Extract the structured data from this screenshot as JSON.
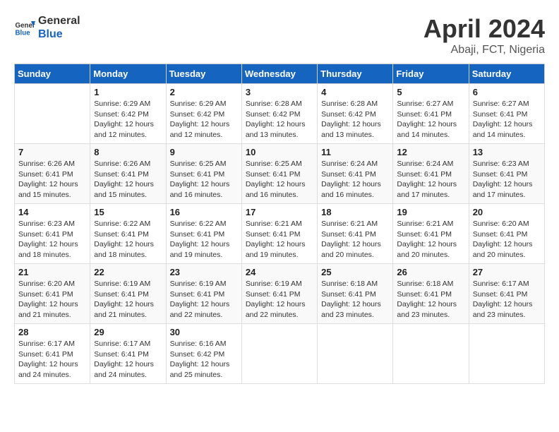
{
  "logo": {
    "general": "General",
    "blue": "Blue"
  },
  "title": "April 2024",
  "location": "Abaji, FCT, Nigeria",
  "weekdays": [
    "Sunday",
    "Monday",
    "Tuesday",
    "Wednesday",
    "Thursday",
    "Friday",
    "Saturday"
  ],
  "weeks": [
    [
      {
        "day": "",
        "info": ""
      },
      {
        "day": "1",
        "info": "Sunrise: 6:29 AM\nSunset: 6:42 PM\nDaylight: 12 hours\nand 12 minutes."
      },
      {
        "day": "2",
        "info": "Sunrise: 6:29 AM\nSunset: 6:42 PM\nDaylight: 12 hours\nand 12 minutes."
      },
      {
        "day": "3",
        "info": "Sunrise: 6:28 AM\nSunset: 6:42 PM\nDaylight: 12 hours\nand 13 minutes."
      },
      {
        "day": "4",
        "info": "Sunrise: 6:28 AM\nSunset: 6:42 PM\nDaylight: 12 hours\nand 13 minutes."
      },
      {
        "day": "5",
        "info": "Sunrise: 6:27 AM\nSunset: 6:41 PM\nDaylight: 12 hours\nand 14 minutes."
      },
      {
        "day": "6",
        "info": "Sunrise: 6:27 AM\nSunset: 6:41 PM\nDaylight: 12 hours\nand 14 minutes."
      }
    ],
    [
      {
        "day": "7",
        "info": "Sunrise: 6:26 AM\nSunset: 6:41 PM\nDaylight: 12 hours\nand 15 minutes."
      },
      {
        "day": "8",
        "info": "Sunrise: 6:26 AM\nSunset: 6:41 PM\nDaylight: 12 hours\nand 15 minutes."
      },
      {
        "day": "9",
        "info": "Sunrise: 6:25 AM\nSunset: 6:41 PM\nDaylight: 12 hours\nand 16 minutes."
      },
      {
        "day": "10",
        "info": "Sunrise: 6:25 AM\nSunset: 6:41 PM\nDaylight: 12 hours\nand 16 minutes."
      },
      {
        "day": "11",
        "info": "Sunrise: 6:24 AM\nSunset: 6:41 PM\nDaylight: 12 hours\nand 16 minutes."
      },
      {
        "day": "12",
        "info": "Sunrise: 6:24 AM\nSunset: 6:41 PM\nDaylight: 12 hours\nand 17 minutes."
      },
      {
        "day": "13",
        "info": "Sunrise: 6:23 AM\nSunset: 6:41 PM\nDaylight: 12 hours\nand 17 minutes."
      }
    ],
    [
      {
        "day": "14",
        "info": "Sunrise: 6:23 AM\nSunset: 6:41 PM\nDaylight: 12 hours\nand 18 minutes."
      },
      {
        "day": "15",
        "info": "Sunrise: 6:22 AM\nSunset: 6:41 PM\nDaylight: 12 hours\nand 18 minutes."
      },
      {
        "day": "16",
        "info": "Sunrise: 6:22 AM\nSunset: 6:41 PM\nDaylight: 12 hours\nand 19 minutes."
      },
      {
        "day": "17",
        "info": "Sunrise: 6:21 AM\nSunset: 6:41 PM\nDaylight: 12 hours\nand 19 minutes."
      },
      {
        "day": "18",
        "info": "Sunrise: 6:21 AM\nSunset: 6:41 PM\nDaylight: 12 hours\nand 20 minutes."
      },
      {
        "day": "19",
        "info": "Sunrise: 6:21 AM\nSunset: 6:41 PM\nDaylight: 12 hours\nand 20 minutes."
      },
      {
        "day": "20",
        "info": "Sunrise: 6:20 AM\nSunset: 6:41 PM\nDaylight: 12 hours\nand 20 minutes."
      }
    ],
    [
      {
        "day": "21",
        "info": "Sunrise: 6:20 AM\nSunset: 6:41 PM\nDaylight: 12 hours\nand 21 minutes."
      },
      {
        "day": "22",
        "info": "Sunrise: 6:19 AM\nSunset: 6:41 PM\nDaylight: 12 hours\nand 21 minutes."
      },
      {
        "day": "23",
        "info": "Sunrise: 6:19 AM\nSunset: 6:41 PM\nDaylight: 12 hours\nand 22 minutes."
      },
      {
        "day": "24",
        "info": "Sunrise: 6:19 AM\nSunset: 6:41 PM\nDaylight: 12 hours\nand 22 minutes."
      },
      {
        "day": "25",
        "info": "Sunrise: 6:18 AM\nSunset: 6:41 PM\nDaylight: 12 hours\nand 23 minutes."
      },
      {
        "day": "26",
        "info": "Sunrise: 6:18 AM\nSunset: 6:41 PM\nDaylight: 12 hours\nand 23 minutes."
      },
      {
        "day": "27",
        "info": "Sunrise: 6:17 AM\nSunset: 6:41 PM\nDaylight: 12 hours\nand 23 minutes."
      }
    ],
    [
      {
        "day": "28",
        "info": "Sunrise: 6:17 AM\nSunset: 6:41 PM\nDaylight: 12 hours\nand 24 minutes."
      },
      {
        "day": "29",
        "info": "Sunrise: 6:17 AM\nSunset: 6:41 PM\nDaylight: 12 hours\nand 24 minutes."
      },
      {
        "day": "30",
        "info": "Sunrise: 6:16 AM\nSunset: 6:42 PM\nDaylight: 12 hours\nand 25 minutes."
      },
      {
        "day": "",
        "info": ""
      },
      {
        "day": "",
        "info": ""
      },
      {
        "day": "",
        "info": ""
      },
      {
        "day": "",
        "info": ""
      }
    ]
  ]
}
